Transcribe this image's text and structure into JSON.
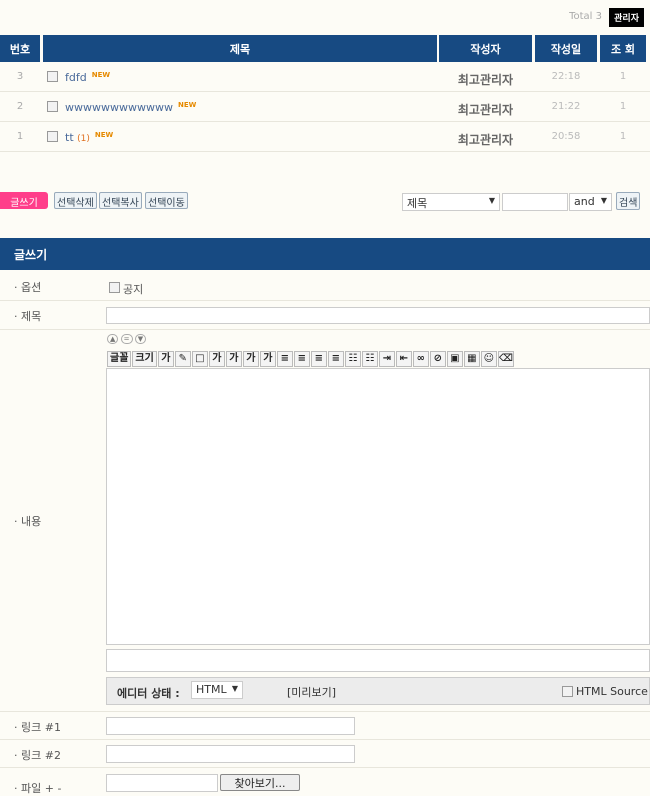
{
  "top": {
    "total": "Total 3",
    "admin_label": "관리자"
  },
  "table": {
    "headers": [
      "번호",
      "제목",
      "작성자",
      "작성일",
      "조 회"
    ],
    "rows": [
      {
        "num": "3",
        "subject": "fdfd",
        "comments": "",
        "new": "NEW",
        "author": "최고관리자",
        "date": "22:18",
        "hits": "1"
      },
      {
        "num": "2",
        "subject": "wwwwwwwwwwww",
        "comments": "",
        "new": "NEW",
        "author": "최고관리자",
        "date": "21:22",
        "hits": "1"
      },
      {
        "num": "1",
        "subject": "tt",
        "comments": "(1)",
        "new": "NEW",
        "author": "최고관리자",
        "date": "20:58",
        "hits": "1"
      }
    ]
  },
  "actions": {
    "write": "글쓰기",
    "delete": "선택삭제",
    "copy": "선택복사",
    "move": "선택이동"
  },
  "search": {
    "field": "제목",
    "query": "",
    "op": "and",
    "button": "검색"
  },
  "form": {
    "title": "글쓰기",
    "option_label": "· 옵션",
    "notice": "공지",
    "subject_label": "· 제목",
    "content_label": "· 내용",
    "toolbar": [
      "글꼴",
      "크기",
      "가",
      "✎",
      "□",
      "가",
      "가",
      "가",
      "가",
      "≡",
      "≡",
      "≡",
      "≡",
      "☷",
      "☷",
      "⇥",
      "⇤",
      "∞",
      "⊘",
      "▣",
      "▦",
      "☺",
      "⌫"
    ],
    "editor_status_label": "에디터 상태 :",
    "editor_mode": "HTML",
    "preview": "[미리보기]",
    "html_source": "HTML Source",
    "link1_label": "· 링크 #1",
    "link2_label": "· 링크 #2",
    "file_label": "· 파일 + -",
    "browse": "찾아보기..."
  }
}
